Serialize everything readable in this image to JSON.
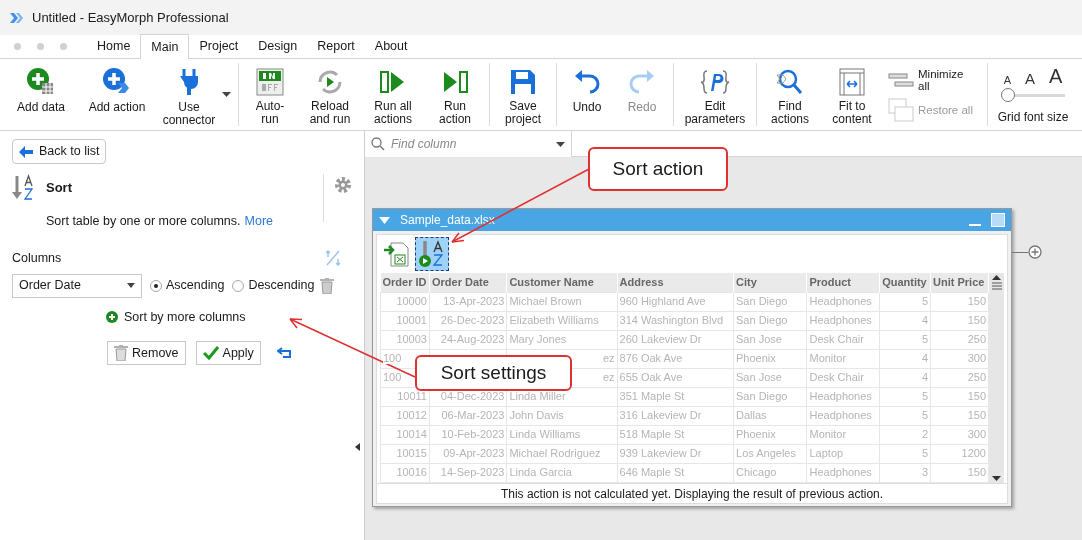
{
  "window": {
    "title": "Untitled - EasyMorph Professional"
  },
  "tabs": [
    {
      "label": "Home",
      "selected": false
    },
    {
      "label": "Main",
      "selected": true
    },
    {
      "label": "Project",
      "selected": false
    },
    {
      "label": "Design",
      "selected": false
    },
    {
      "label": "Report",
      "selected": false
    },
    {
      "label": "About",
      "selected": false
    }
  ],
  "ribbon": [
    {
      "kind": "large",
      "label": "Add data",
      "disabled": false
    },
    {
      "kind": "large",
      "label": "Add action",
      "disabled": false
    },
    {
      "kind": "dropdown",
      "label": "Use\nconnector",
      "disabled": false
    },
    {
      "kind": "sep"
    },
    {
      "kind": "large",
      "label": "Auto-\nrun",
      "disabled": false
    },
    {
      "kind": "large",
      "label": "Reload\nand run",
      "disabled": false
    },
    {
      "kind": "large",
      "label": "Run all\nactions",
      "disabled": false
    },
    {
      "kind": "large",
      "label": "Run\naction",
      "disabled": false
    },
    {
      "kind": "sep"
    },
    {
      "kind": "large",
      "label": "Save\nproject",
      "disabled": false
    },
    {
      "kind": "sep"
    },
    {
      "kind": "large",
      "label": "Undo",
      "disabled": false
    },
    {
      "kind": "large",
      "label": "Redo",
      "disabled": true
    },
    {
      "kind": "sep"
    },
    {
      "kind": "large",
      "label": "Edit\nparameters",
      "disabled": false
    },
    {
      "kind": "sep"
    },
    {
      "kind": "large",
      "label": "Find\nactions",
      "disabled": false
    },
    {
      "kind": "large",
      "label": "Fit to\ncontent",
      "disabled": false
    },
    {
      "kind": "pair",
      "items": [
        {
          "label": "Minimize\nall",
          "disabled": false
        },
        {
          "label": "Restore all",
          "disabled": true
        }
      ]
    },
    {
      "kind": "sep"
    },
    {
      "kind": "fontsize",
      "glyphs": [
        "A",
        "A",
        "A"
      ],
      "label": "Grid font size",
      "level": 0
    }
  ],
  "panel": {
    "back": "Back to list",
    "action_title": "Sort",
    "description": "Sort table by one or more columns.",
    "more_link": "More",
    "columns_label": "Columns",
    "sort_rows": [
      {
        "column": "Order Date",
        "options": [
          {
            "label": "Ascending",
            "selected": true
          },
          {
            "label": "Descending",
            "selected": false
          }
        ]
      }
    ],
    "add_more": "Sort by more columns",
    "buttons": [
      {
        "kind": "remove",
        "label": "Remove"
      },
      {
        "kind": "apply",
        "label": "Apply"
      }
    ]
  },
  "search": {
    "placeholder": "Find column"
  },
  "table_window": {
    "title": "Sample_data.xlsx",
    "columns": [
      "Order ID",
      "Order Date",
      "Customer Name",
      "Address",
      "City",
      "Product",
      "Quantity",
      "Unit Price"
    ],
    "rows": [
      [
        "10000",
        "13-Apr-2023",
        "Michael Brown",
        "960 Highland Ave",
        "San Diego",
        "Headphones",
        "5",
        "150"
      ],
      [
        "10001",
        "26-Dec-2023",
        "Elizabeth Williams",
        "314 Washington Blvd",
        "San Diego",
        "Headphones",
        "4",
        "150"
      ],
      [
        "10003",
        "24-Aug-2023",
        "Mary Jones",
        "260 Lakeview Dr",
        "San Jose",
        "Desk Chair",
        "5",
        "250"
      ],
      [
        "100",
        null,
        "ez",
        "876 Oak Ave",
        "Phoenix",
        "Monitor",
        "4",
        "300"
      ],
      [
        "100",
        null,
        "ez",
        "655 Oak Ave",
        "San Jose",
        "Desk Chair",
        "4",
        "250"
      ],
      [
        "10011",
        "04-Dec-2023",
        "Linda Miller",
        "351 Maple St",
        "San Diego",
        "Headphones",
        "5",
        "150"
      ],
      [
        "10012",
        "06-Mar-2023",
        "John Davis",
        "316 Lakeview Dr",
        "Dallas",
        "Headphones",
        "5",
        "150"
      ],
      [
        "10014",
        "10-Feb-2023",
        "Linda Williams",
        "518 Maple St",
        "Phoenix",
        "Monitor",
        "2",
        "300"
      ],
      [
        "10015",
        "09-Apr-2023",
        "Michael Rodriguez",
        "939 Lakeview Dr",
        "Los Angeles",
        "Laptop",
        "5",
        "1200"
      ],
      [
        "10016",
        "14-Sep-2023",
        "Linda Garcia",
        "646 Maple St",
        "Chicago",
        "Headphones",
        "3",
        "150"
      ]
    ],
    "status": "This action is not calculated yet. Displaying the result of previous action."
  },
  "callouts": [
    "Sort action",
    "Sort settings"
  ]
}
